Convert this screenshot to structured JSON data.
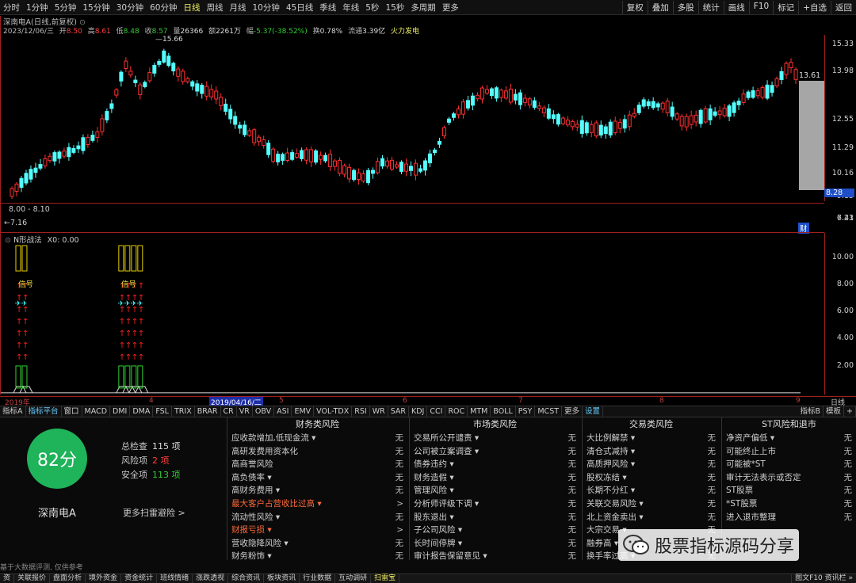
{
  "toolbar": {
    "periods": [
      "分时",
      "1分钟",
      "5分钟",
      "15分钟",
      "30分钟",
      "60分钟",
      "日线",
      "周线",
      "月线",
      "10分钟",
      "45日线",
      "季线",
      "年线",
      "5秒",
      "15秒",
      "多周期",
      "更多"
    ],
    "active_period": "日线",
    "right_buttons": [
      "复权",
      "叠加",
      "多股",
      "统计",
      "画线",
      "F10",
      "标记",
      "+自选",
      "返回"
    ]
  },
  "quote": {
    "title": "深南电A(日线,前复权)",
    "date": "2023/12/06/三",
    "open_label": "开",
    "open": "8.50",
    "high_label": "高",
    "high": "8.61",
    "low_label": "低",
    "low": "8.48",
    "close_label": "收",
    "close": "8.57",
    "volume_label": "量",
    "volume": "26366",
    "amount_label": "额",
    "amount": "2261万",
    "change_label": "幅",
    "change": "-5.37(-38.52%)",
    "turnover_label": "换",
    "turnover": "0.78%",
    "float_label": "流通",
    "float": "3.39亿",
    "concept": "火力发电"
  },
  "price_axis": [
    "15.33",
    "13.98",
    "13.61",
    "12.55",
    "11.29",
    "10.16",
    "9.15",
    "8.28",
    "6.23"
  ],
  "mid_pane": {
    "range": "8.00 - 8.10",
    "lowmark": "7.16",
    "axis": "7.41",
    "badge": "财"
  },
  "peak_label": "15.66",
  "indicator": {
    "name": "N形战法",
    "x0": "X0: 0.00",
    "axis": [
      "10.00",
      "8.00",
      "6.00",
      "4.00",
      "2.00"
    ],
    "signal1": "信号",
    "signal2": "信号"
  },
  "dates": {
    "year": "2019年",
    "m4": "4",
    "cursor": "2019/04/16/二",
    "m5": "5",
    "m6": "6",
    "m7": "7",
    "m8": "8",
    "m9": "9",
    "period": "日线"
  },
  "tabs": [
    "指标A",
    "指标平台",
    "窗口",
    "MACD",
    "DMI",
    "DMA",
    "FSL",
    "TRIX",
    "BRAR",
    "CR",
    "VR",
    "OBV",
    "ASI",
    "EMV",
    "VOL-TDX",
    "RSI",
    "WR",
    "SAR",
    "KDJ",
    "CCI",
    "ROC",
    "MTM",
    "BOLL",
    "PSY",
    "MCST",
    "更多",
    "设置"
  ],
  "tabs_right": [
    "指标B",
    "模板",
    "+"
  ],
  "scan": {
    "score": "82分",
    "stock": "深南电A",
    "total_label": "总检查",
    "total": "115 项",
    "risk_label": "风险项",
    "risk": "2 项",
    "safe_label": "安全项",
    "safe": "113 项",
    "more": "更多扫雷避险 >",
    "note": "基于大数据评测, 仅供参考"
  },
  "categories": [
    {
      "title": "财务类风险",
      "rows": [
        {
          "label": "应收款增加,低现金流 ▾",
          "val": "无",
          "hot": false
        },
        {
          "label": "高研发费用资本化",
          "val": "无",
          "hot": false
        },
        {
          "label": "高商誉风险",
          "val": "无",
          "hot": false
        },
        {
          "label": "高负债率 ▾",
          "val": "无",
          "hot": false
        },
        {
          "label": "高财务费用 ▾",
          "val": "无",
          "hot": false
        },
        {
          "label": "最大客户占营收比过高 ▾",
          "val": ">",
          "hot": true
        },
        {
          "label": "流动性风险 ▾",
          "val": "无",
          "hot": false
        },
        {
          "label": "财报亏损 ▾",
          "val": ">",
          "hot": true
        },
        {
          "label": "营收隐降风险 ▾",
          "val": "无",
          "hot": false
        },
        {
          "label": "财务粉饰 ▾",
          "val": "无",
          "hot": false
        }
      ]
    },
    {
      "title": "市场类风险",
      "rows": [
        {
          "label": "交易所公开谴责 ▾",
          "val": "无",
          "hot": false
        },
        {
          "label": "公司被立案调查 ▾",
          "val": "无",
          "hot": false
        },
        {
          "label": "债券违约 ▾",
          "val": "无",
          "hot": false
        },
        {
          "label": "财务造假 ▾",
          "val": "无",
          "hot": false
        },
        {
          "label": "管理风险 ▾",
          "val": "无",
          "hot": false
        },
        {
          "label": "分析师评级下调 ▾",
          "val": "无",
          "hot": false
        },
        {
          "label": "股东退出 ▾",
          "val": "无",
          "hot": false
        },
        {
          "label": "子公司风险 ▾",
          "val": "无",
          "hot": false
        },
        {
          "label": "长时间停牌 ▾",
          "val": "无",
          "hot": false
        },
        {
          "label": "审计报告保留意见 ▾",
          "val": "无",
          "hot": false
        }
      ]
    },
    {
      "title": "交易类风险",
      "rows": [
        {
          "label": "大比例解禁 ▾",
          "val": "无",
          "hot": false
        },
        {
          "label": "清仓式减持 ▾",
          "val": "无",
          "hot": false
        },
        {
          "label": "高质押风险 ▾",
          "val": "无",
          "hot": false
        },
        {
          "label": "股权冻结 ▾",
          "val": "无",
          "hot": false
        },
        {
          "label": "长期不分红 ▾",
          "val": "无",
          "hot": false
        },
        {
          "label": "关联交易风险 ▾",
          "val": "无",
          "hot": false
        },
        {
          "label": "北上资金卖出 ▾",
          "val": "无",
          "hot": false
        },
        {
          "label": "大宗交易 ▾",
          "val": "无",
          "hot": false
        },
        {
          "label": "融券高 ▾",
          "val": "无",
          "hot": false
        },
        {
          "label": "换手率过高 ▾",
          "val": "无",
          "hot": false
        }
      ]
    },
    {
      "title": "ST风险和退市",
      "rows": [
        {
          "label": "净资产偏低 ▾",
          "val": "无",
          "hot": false
        },
        {
          "label": "可能终止上市",
          "val": "无",
          "hot": false
        },
        {
          "label": "可能被*ST",
          "val": "无",
          "hot": false
        },
        {
          "label": "审计无法表示或否定",
          "val": "无",
          "hot": false
        },
        {
          "label": "ST股票",
          "val": "无",
          "hot": false
        },
        {
          "label": "*ST股票",
          "val": "无",
          "hot": false
        },
        {
          "label": "进入退市整理",
          "val": "无",
          "hot": false
        },
        {
          "label": "",
          "val": "",
          "hot": false
        },
        {
          "label": "",
          "val": "",
          "hot": false
        },
        {
          "label": "",
          "val": "",
          "hot": false
        }
      ]
    }
  ],
  "statusbar": [
    "资",
    "关联报价",
    "盘面分析",
    "境外资金",
    "资金统计",
    "班线情绪",
    "涨跌透视",
    "综合资讯",
    "板块资讯",
    "行业数据",
    "互动调研",
    "扫雷宝"
  ],
  "status_active": "扫雷宝",
  "status_right": "图文F10  资讯栏 »",
  "watermark": "股票指标源码分享",
  "colors": {
    "up": "#ff3030",
    "down": "#54ffff",
    "accent": "#f0f060",
    "score": "#1fb35a"
  }
}
